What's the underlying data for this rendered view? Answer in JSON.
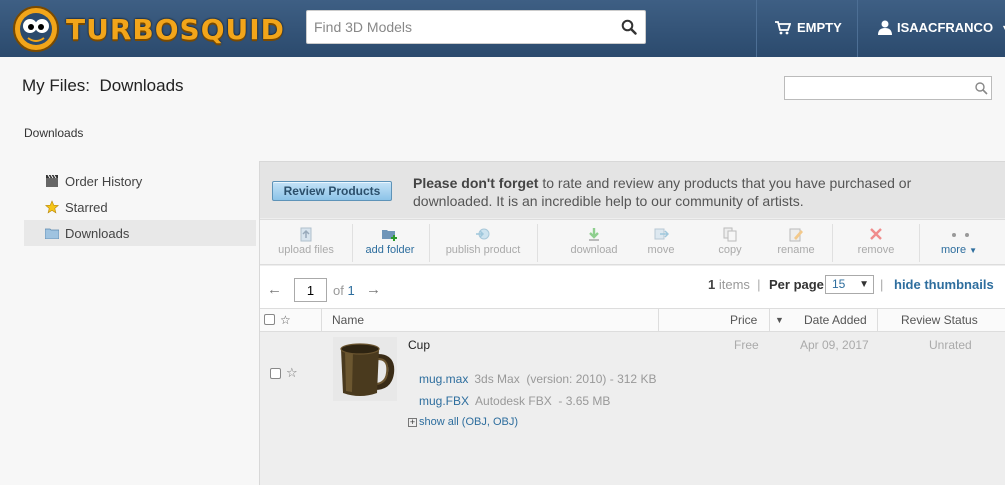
{
  "header": {
    "brand": "TURBOSQUID",
    "search_placeholder": "Find 3D Models",
    "cart_label": "EMPTY",
    "user_name": "ISAACFRANCO"
  },
  "page": {
    "title": "My Files:  Downloads",
    "breadcrumb": "Downloads",
    "filter_placeholder": ""
  },
  "sidebar": {
    "items": [
      {
        "label": "Order History",
        "icon": "clapperboard-icon",
        "active": false
      },
      {
        "label": "Starred",
        "icon": "star-icon",
        "active": false
      },
      {
        "label": "Downloads",
        "icon": "folder-icon",
        "active": true
      }
    ]
  },
  "promo": {
    "button_label": "Review Products",
    "bold_text": "Please don't forget",
    "text": " to rate and review any products that you have purchased or downloaded. It is an incredible help to our community of artists."
  },
  "toolbar": {
    "upload": "upload files",
    "add_folder": "add folder",
    "publish": "publish product",
    "download": "download",
    "move": "move",
    "copy": "copy",
    "rename": "rename",
    "remove": "remove",
    "more": "more"
  },
  "pager": {
    "prev_arrow": "←",
    "next_arrow": "→",
    "current_page": "1",
    "of_label": "of",
    "total_pages": "1",
    "item_count": "1",
    "items_label": "items",
    "per_page_label": "Per page:",
    "per_page_value": "15",
    "hide_thumbnails": "hide thumbnails"
  },
  "table": {
    "columns": {
      "name": "Name",
      "price": "Price",
      "date_added": "Date Added",
      "review_status": "Review Status"
    },
    "rows": [
      {
        "name": "Cup",
        "price": "Free",
        "date": "Apr 09, 2017",
        "status": "Unrated",
        "files": [
          {
            "file": "mug.max",
            "info": "3ds Max  (version: 2010) - 312 KB"
          },
          {
            "file": "mug.FBX",
            "info": "Autodesk FBX  - 3.65 MB"
          }
        ],
        "show_all": "show all (OBJ, OBJ)"
      }
    ]
  },
  "colors": {
    "header_bg": "#2b4a6d",
    "brand": "#f2a51a",
    "link": "#2e6e9e"
  }
}
